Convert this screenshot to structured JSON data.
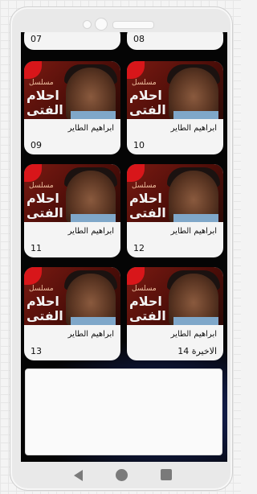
{
  "episodes_partial": [
    {
      "num": "07"
    },
    {
      "num": "08"
    }
  ],
  "thumbnail": {
    "badge_line1": "مسلسل",
    "badge_line2": "احلام",
    "badge_line3": "الفتى"
  },
  "episodes": [
    {
      "name": "ابراهيم الطاير",
      "num": "09"
    },
    {
      "name": "ابراهيم الطاير",
      "num": "10"
    },
    {
      "name": "ابراهيم الطاير",
      "num": "11"
    },
    {
      "name": "ابراهيم الطاير",
      "num": "12"
    },
    {
      "name": "ابراهيم الطاير",
      "num": "13"
    },
    {
      "name": "ابراهيم الطاير",
      "num": "الاخيرة 14"
    }
  ]
}
